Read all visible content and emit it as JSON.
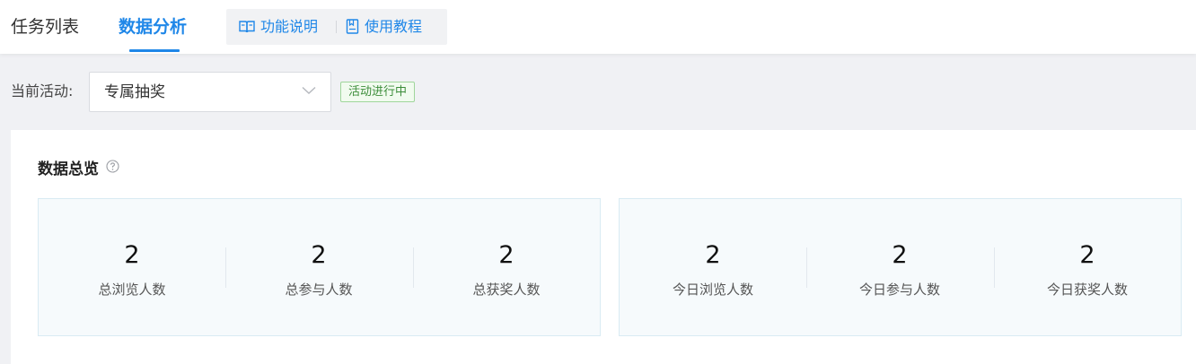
{
  "tabs": [
    {
      "label": "任务列表",
      "active": false
    },
    {
      "label": "数据分析",
      "active": true
    }
  ],
  "help_links": {
    "feature_desc": "功能说明",
    "tutorial": "使用教程"
  },
  "activity": {
    "label": "当前活动:",
    "selected": "专属抽奖",
    "status": "活动进行中"
  },
  "overview": {
    "title": "数据总览",
    "total": [
      {
        "value": "2",
        "label": "总浏览人数"
      },
      {
        "value": "2",
        "label": "总参与人数"
      },
      {
        "value": "2",
        "label": "总获奖人数"
      }
    ],
    "today": [
      {
        "value": "2",
        "label": "今日浏览人数"
      },
      {
        "value": "2",
        "label": "今日参与人数"
      },
      {
        "value": "2",
        "label": "今日获奖人数"
      }
    ]
  },
  "colors": {
    "accent": "#1f87e8",
    "status_green": "#3c8d3a",
    "stat_bg": "#f6fafc"
  },
  "icons": [
    "book-open-icon",
    "bookmark-icon",
    "chevron-down-icon",
    "question-circle-icon"
  ]
}
